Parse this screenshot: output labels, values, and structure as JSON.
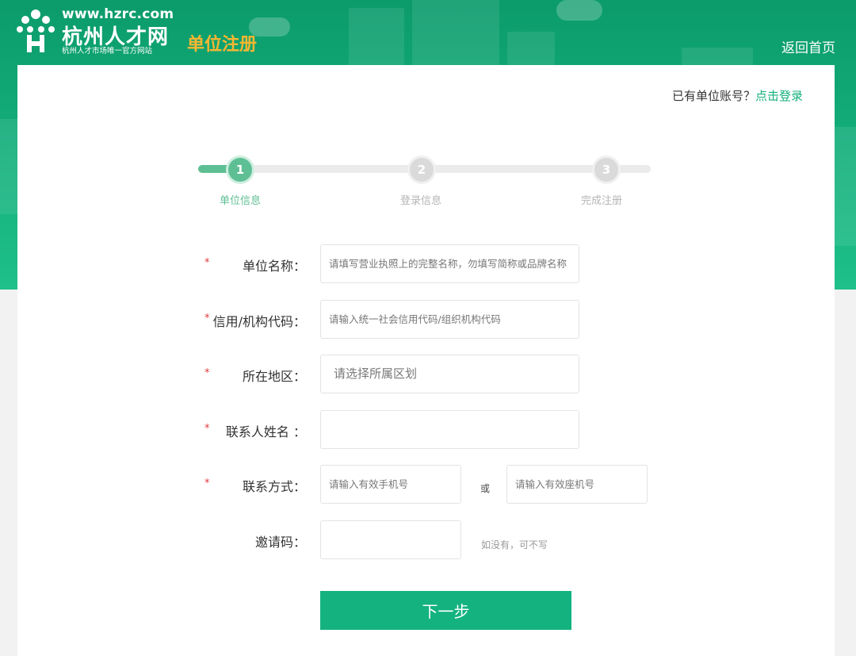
{
  "header": {
    "logo_url": "www.hzrc.com",
    "logo_name": "杭州人才网",
    "logo_tagline": "杭州人才市场唯一官方网站",
    "page_title": "单位注册",
    "back_home": "返回首页"
  },
  "login_hint": {
    "text": "已有单位账号？",
    "link": "点击登录"
  },
  "steps": [
    {
      "number": "1",
      "label": "单位信息",
      "state": "active"
    },
    {
      "number": "2",
      "label": "登录信息",
      "state": "todo"
    },
    {
      "number": "3",
      "label": "完成注册",
      "state": "todo"
    }
  ],
  "form": {
    "required_mark": "*",
    "company_name": {
      "label": "单位名称：",
      "placeholder": "请填写营业执照上的完整名称，勿填写简称或品牌名称",
      "value": ""
    },
    "credit_code": {
      "label": "信用/机构代码：",
      "placeholder": "请输入统一社会信用代码/组织机构代码",
      "value": ""
    },
    "region": {
      "label": "所在地区：",
      "placeholder": "请选择所属区划"
    },
    "contact_name": {
      "label": "联系人姓名 ：",
      "placeholder": "",
      "value": ""
    },
    "contact": {
      "label": "联系方式：",
      "mobile_placeholder": "请输入有效手机号",
      "or": "或",
      "landline_placeholder": "请输入有效座机号"
    },
    "invite_code": {
      "label": "邀请码：",
      "placeholder": "",
      "note": "如没有，可不写"
    },
    "next_button": "下一步"
  },
  "colors": {
    "brand_green": "#14b07c",
    "accent_orange": "#f7b731",
    "step_active": "#5fbf94",
    "required_red": "#e0393e"
  }
}
